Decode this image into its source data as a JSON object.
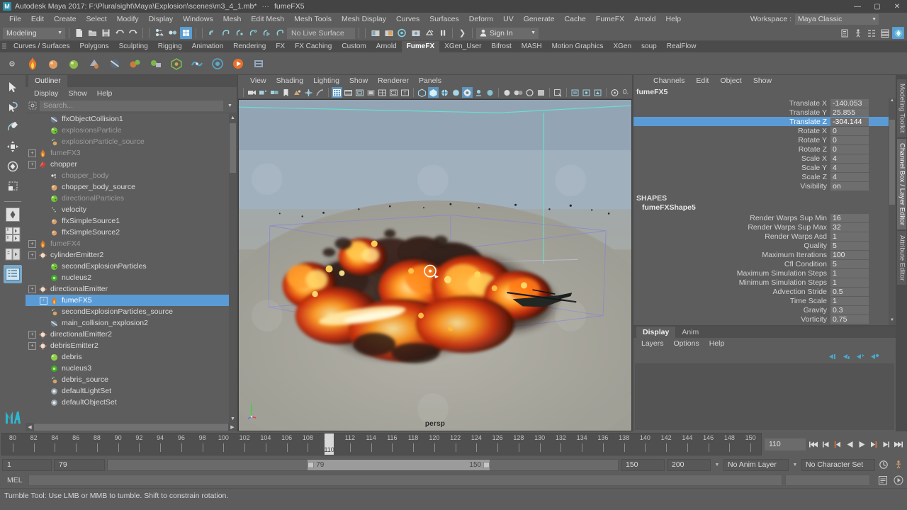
{
  "titlebar": {
    "logo": "M",
    "title": "Autodesk Maya 2017: F:\\Pluralsight\\Maya\\Explosion\\scenes\\m3_4_1.mb*",
    "separator": "···",
    "object": "fumeFX5",
    "minimize": "—",
    "maximize": "▢",
    "close": "✕"
  },
  "menubar": {
    "items": [
      "File",
      "Edit",
      "Create",
      "Select",
      "Modify",
      "Display",
      "Windows",
      "Mesh",
      "Edit Mesh",
      "Mesh Tools",
      "Mesh Display",
      "Curves",
      "Surfaces",
      "Deform",
      "UV",
      "Generate",
      "Cache",
      "FumeFX",
      "Arnold",
      "Help"
    ],
    "workspace_label": "Workspace :",
    "workspace_value": "Maya Classic"
  },
  "statusline": {
    "mode": "Modeling",
    "live_surface": "No Live Surface",
    "sign_in": "Sign In"
  },
  "shelf": {
    "tabs": [
      "Curves / Surfaces",
      "Polygons",
      "Sculpting",
      "Rigging",
      "Animation",
      "Rendering",
      "FX",
      "FX Caching",
      "Custom",
      "Arnold",
      "FumeFX",
      "XGen_User",
      "Bifrost",
      "MASH",
      "Motion Graphics",
      "XGen",
      "soup",
      "RealFlow"
    ],
    "active_tab": "FumeFX"
  },
  "outliner": {
    "tab": "Outliner",
    "menus": [
      "Display",
      "Show",
      "Help"
    ],
    "search_placeholder": "Search...",
    "items": [
      {
        "label": "ffxObjectCollision1",
        "indent": 1,
        "expand": "none",
        "icon": "collision-icon",
        "dim": false
      },
      {
        "label": "explosionsParticle",
        "indent": 1,
        "expand": "none",
        "icon": "particle-icon",
        "dim": true
      },
      {
        "label": "explosionParticle_source",
        "indent": 1,
        "expand": "none",
        "icon": "source-icon",
        "dim": true
      },
      {
        "label": "fumeFX3",
        "indent": 0,
        "expand": "plus",
        "icon": "fume-icon",
        "dim": true
      },
      {
        "label": "chopper",
        "indent": 0,
        "expand": "plus",
        "icon": "mesh-icon",
        "dim": false
      },
      {
        "label": "chopper_body",
        "indent": 1,
        "expand": "none",
        "icon": "body-icon",
        "dim": true
      },
      {
        "label": "chopper_body_source",
        "indent": 1,
        "expand": "none",
        "icon": "sphere-icon",
        "dim": false
      },
      {
        "label": "directionalParticles",
        "indent": 1,
        "expand": "none",
        "icon": "particle-icon",
        "dim": true
      },
      {
        "label": "velocity",
        "indent": 1,
        "expand": "none",
        "icon": "velocity-icon",
        "dim": false
      },
      {
        "label": "ffxSimpleSource1",
        "indent": 1,
        "expand": "none",
        "icon": "sphere-icon",
        "dim": false
      },
      {
        "label": "ffxSimpleSource2",
        "indent": 1,
        "expand": "none",
        "icon": "sphere-icon",
        "dim": false
      },
      {
        "label": "fumeFX4",
        "indent": 0,
        "expand": "plus",
        "icon": "fume-icon",
        "dim": true
      },
      {
        "label": "cylinderEmitter2",
        "indent": 0,
        "expand": "plus",
        "icon": "emitter-icon",
        "dim": false
      },
      {
        "label": "secondExplosionParticles",
        "indent": 1,
        "expand": "none",
        "icon": "particle-icon",
        "dim": false
      },
      {
        "label": "nucleus2",
        "indent": 1,
        "expand": "none",
        "icon": "nucleus-icon",
        "dim": false
      },
      {
        "label": "directionalEmitter",
        "indent": 0,
        "expand": "plus",
        "icon": "emitter-icon",
        "dim": false
      },
      {
        "label": "fumeFX5",
        "indent": 1,
        "expand": "plus",
        "icon": "fume-icon",
        "dim": false,
        "selected": true
      },
      {
        "label": "secondExplosionParticles_source",
        "indent": 1,
        "expand": "none",
        "icon": "source-icon",
        "dim": false
      },
      {
        "label": "main_collision_explosion2",
        "indent": 1,
        "expand": "none",
        "icon": "collision-icon",
        "dim": false
      },
      {
        "label": "directionalEmitter2",
        "indent": 0,
        "expand": "plus",
        "icon": "emitter-icon",
        "dim": false
      },
      {
        "label": "debrisEmitter2",
        "indent": 0,
        "expand": "plus",
        "icon": "emitter-icon",
        "dim": false
      },
      {
        "label": "debris",
        "indent": 1,
        "expand": "none",
        "icon": "particle-icon",
        "dim": false
      },
      {
        "label": "nucleus3",
        "indent": 1,
        "expand": "none",
        "icon": "nucleus-icon",
        "dim": false
      },
      {
        "label": "debris_source",
        "indent": 1,
        "expand": "none",
        "icon": "source-icon",
        "dim": false
      },
      {
        "label": "defaultLightSet",
        "indent": 1,
        "expand": "none",
        "icon": "set-icon",
        "dim": false
      },
      {
        "label": "defaultObjectSet",
        "indent": 1,
        "expand": "none",
        "icon": "set-icon",
        "dim": false
      }
    ]
  },
  "viewport": {
    "menus": [
      "View",
      "Shading",
      "Lighting",
      "Show",
      "Renderer",
      "Panels"
    ],
    "camera_label": "persp",
    "exposure_value": "0."
  },
  "channelbox": {
    "menus": [
      "Channels",
      "Edit",
      "Object",
      "Show"
    ],
    "object_name": "fumeFX5",
    "transform_channels": [
      {
        "name": "Translate X",
        "value": "-140.053",
        "selected": false
      },
      {
        "name": "Translate Y",
        "value": "25.855",
        "selected": false
      },
      {
        "name": "Translate Z",
        "value": "-304.144",
        "selected": true
      },
      {
        "name": "Rotate X",
        "value": "0",
        "selected": false
      },
      {
        "name": "Rotate Y",
        "value": "0",
        "selected": false
      },
      {
        "name": "Rotate Z",
        "value": "0",
        "selected": false
      },
      {
        "name": "Scale X",
        "value": "4",
        "selected": false
      },
      {
        "name": "Scale Y",
        "value": "4",
        "selected": false
      },
      {
        "name": "Scale Z",
        "value": "4",
        "selected": false
      },
      {
        "name": "Visibility",
        "value": "on",
        "selected": false
      }
    ],
    "shapes_header": "SHAPES",
    "shape_name": "fumeFXShape5",
    "shape_channels": [
      {
        "name": "Render Warps Sup Min",
        "value": "16"
      },
      {
        "name": "Render Warps Sup Max",
        "value": "32"
      },
      {
        "name": "Render Warps Asd",
        "value": "1"
      },
      {
        "name": "Quality",
        "value": "5"
      },
      {
        "name": "Maximum Iterations",
        "value": "100"
      },
      {
        "name": "Cfl Condition",
        "value": "5"
      },
      {
        "name": "Maximum Simulation Steps",
        "value": "1"
      },
      {
        "name": "Minimum Simulation Steps",
        "value": "1"
      },
      {
        "name": "Advection Stride",
        "value": "0.5"
      },
      {
        "name": "Time Scale",
        "value": "1"
      },
      {
        "name": "Gravity",
        "value": "0.3"
      },
      {
        "name": "Vorticity",
        "value": "0.75"
      }
    ]
  },
  "layereditor": {
    "tabs": [
      "Display",
      "Anim"
    ],
    "active_tab": "Display",
    "menus": [
      "Layers",
      "Options",
      "Help"
    ]
  },
  "right_tabs": [
    "Modeling Toolkit",
    "Channel Box / Layer Editor",
    "Attribute Editor"
  ],
  "timeline": {
    "start_tick": 79,
    "end_tick": 151,
    "label_step": 2,
    "labels": [
      80,
      82,
      84,
      86,
      88,
      90,
      92,
      94,
      96,
      98,
      100,
      102,
      104,
      106,
      108,
      110,
      112,
      114,
      116,
      118,
      120,
      122,
      124,
      126,
      128,
      130,
      132,
      134,
      136,
      138,
      140,
      142,
      144,
      146,
      148,
      150
    ],
    "current_frame": 110,
    "current_frame_field": "110"
  },
  "rangeslider": {
    "anim_start": "1",
    "range_start": "79",
    "range_start_handle": "79",
    "range_end_handle": "150",
    "range_end": "150",
    "anim_end": "200",
    "anim_layer": "No Anim Layer",
    "character_set": "No Character Set"
  },
  "commandline": {
    "label": "MEL",
    "input_value": ""
  },
  "helpline": {
    "text": "Tumble Tool: Use LMB or MMB to tumble. Shift to constrain rotation."
  },
  "colors": {
    "selection_blue": "#5b9bd5",
    "panel_bg": "#5d5d5d",
    "accent_teal": "#2a8fa8"
  }
}
